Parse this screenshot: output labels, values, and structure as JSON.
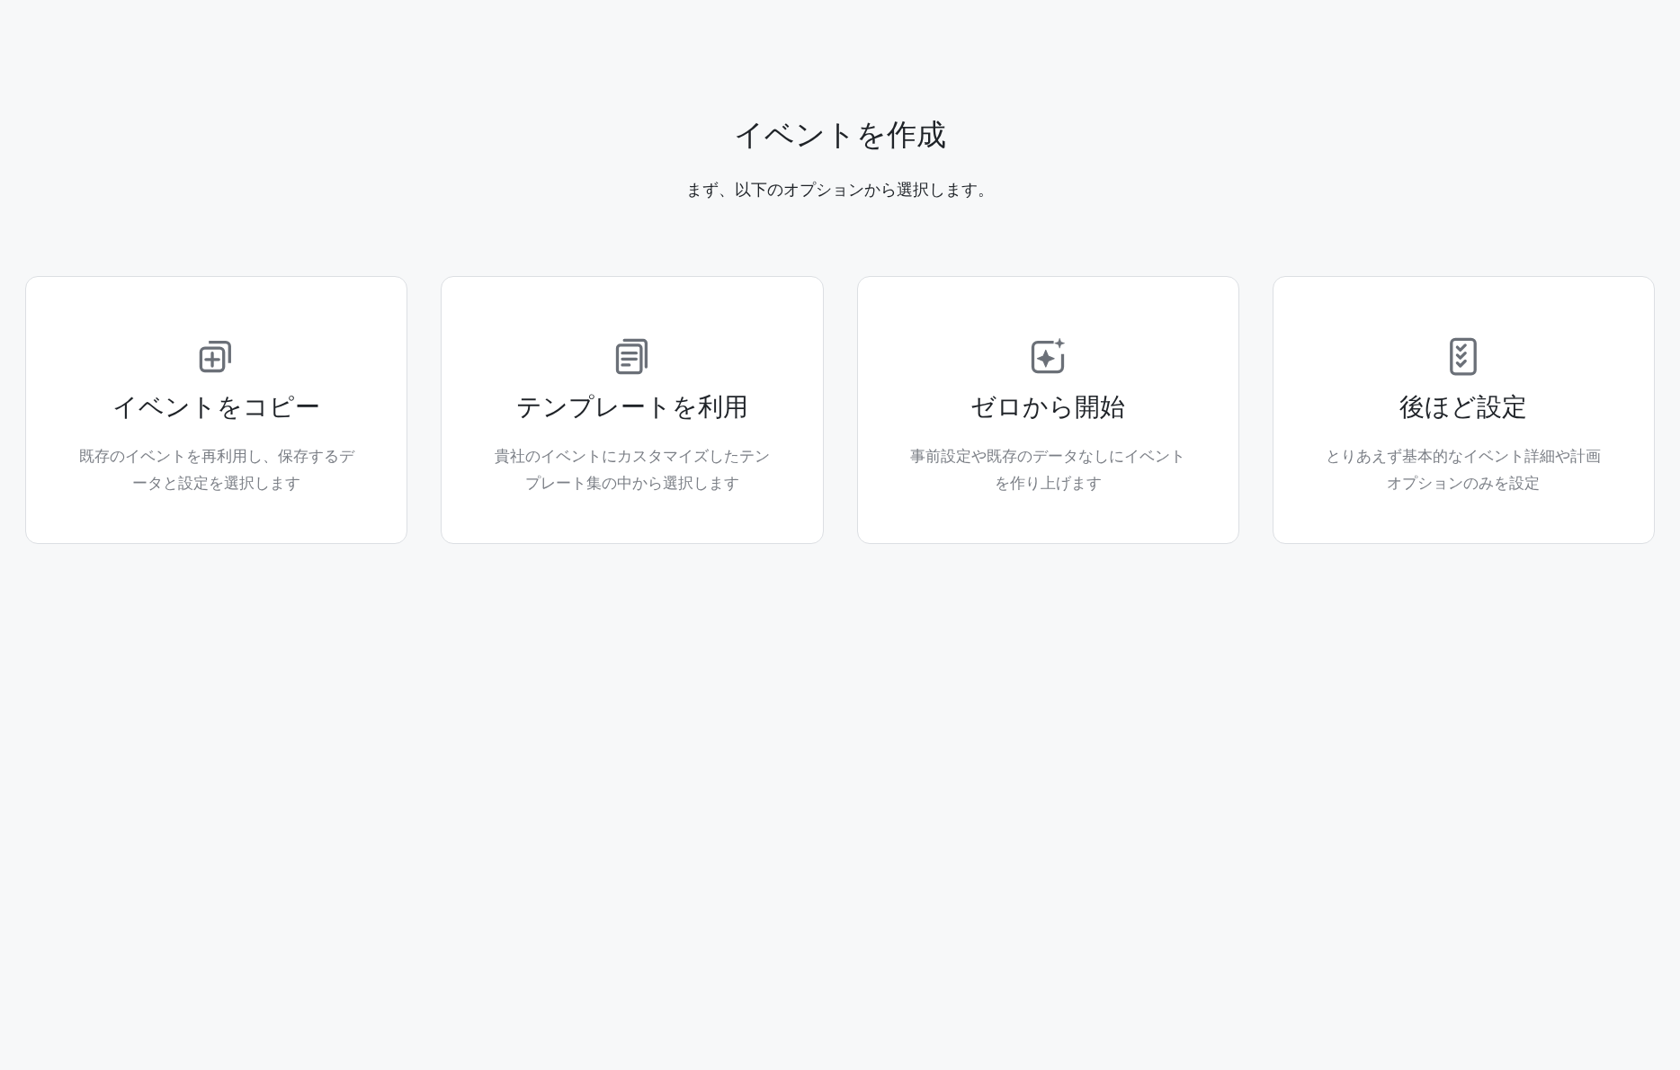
{
  "header": {
    "title": "イベントを作成",
    "subtitle": "まず、以下のオプションから選択します。"
  },
  "options": [
    {
      "kind": "copy",
      "title": "イベントをコピー",
      "description": "既存のイベントを再利用し、保存するデータと設定を選択します"
    },
    {
      "kind": "template",
      "title": "テンプレートを利用",
      "description": "貴社のイベントにカスタマイズしたテンプレート集の中から選択します"
    },
    {
      "kind": "scratch",
      "title": "ゼロから開始",
      "description": "事前設定や既存のデータなしにイベントを作り上げます"
    },
    {
      "kind": "later",
      "title": "後ほど設定",
      "description": "とりあえず基本的なイベント詳細や計画オプションのみを設定"
    }
  ]
}
